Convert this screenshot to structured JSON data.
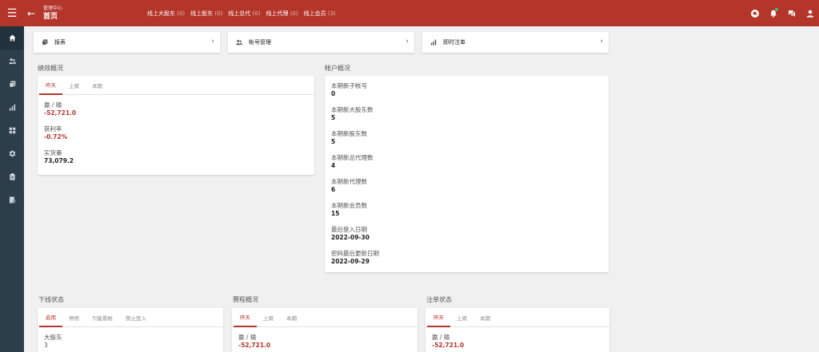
{
  "header": {
    "breadcrumb": "管理中心",
    "title": "首页",
    "links": [
      {
        "label": "线上大股东",
        "count": "(0)"
      },
      {
        "label": "线上股东",
        "count": "(0)"
      },
      {
        "label": "线上总代",
        "count": "(0)"
      },
      {
        "label": "线上代理",
        "count": "(0)"
      },
      {
        "label": "线上会员",
        "count": "(3)"
      }
    ],
    "icons": [
      "search-icon",
      "bell-icon",
      "chat-icon",
      "user-icon"
    ]
  },
  "sidebar": {
    "icons": [
      "home-icon",
      "users-icon",
      "documents-icon",
      "bar-chart-icon",
      "grid-icon",
      "settings-icon",
      "clipboard-icon",
      "notes-icon"
    ]
  },
  "quick_links": [
    {
      "label": "报表",
      "icon": "documents-icon"
    },
    {
      "label": "帐号管理",
      "icon": "users-icon"
    },
    {
      "label": "即时注单",
      "icon": "bar-chart-icon"
    }
  ],
  "performance": {
    "title": "绩效概况",
    "tabs": [
      "昨天",
      "上周",
      "本期"
    ],
    "items": [
      {
        "label": "赢 / 输",
        "value": "-52,721.0"
      },
      {
        "label": "获利率",
        "value": "-0.72%"
      },
      {
        "label": "实货量",
        "value": "73,079.2"
      }
    ]
  },
  "accounts": {
    "title": "帐户概况",
    "items": [
      {
        "label": "本期新子帐号",
        "value": "0"
      },
      {
        "label": "本期新大股东数",
        "value": "5"
      },
      {
        "label": "本期新股东数",
        "value": "5"
      },
      {
        "label": "本期新总代理数",
        "value": "4"
      },
      {
        "label": "本期新代理数",
        "value": "6"
      },
      {
        "label": "本期新会员数",
        "value": "15"
      },
      {
        "label": "最后登入日期",
        "value": "2022-09-30"
      },
      {
        "label": "密码最后更新日期",
        "value": "2022-09-29"
      }
    ]
  },
  "downline": {
    "title": "下线状态",
    "tabs": [
      "启用",
      "停用",
      "只能看帐",
      "禁止登入"
    ],
    "items": [
      {
        "label": "大股东",
        "value": "3"
      }
    ]
  },
  "events": {
    "title": "赛程概况",
    "tabs": [
      "昨天",
      "上周",
      "本期"
    ],
    "items": [
      {
        "label": "赢 / 输",
        "value": "-52,721.0"
      }
    ]
  },
  "bets": {
    "title": "注单状态",
    "tabs": [
      "昨天",
      "上周",
      "本期"
    ],
    "items": [
      {
        "label": "赢 / 输",
        "value": "-52,721.0"
      }
    ]
  },
  "colors": {
    "brand": "#b4352a",
    "sidebar": "#2c3e4a",
    "badge": "#3ec46d"
  }
}
